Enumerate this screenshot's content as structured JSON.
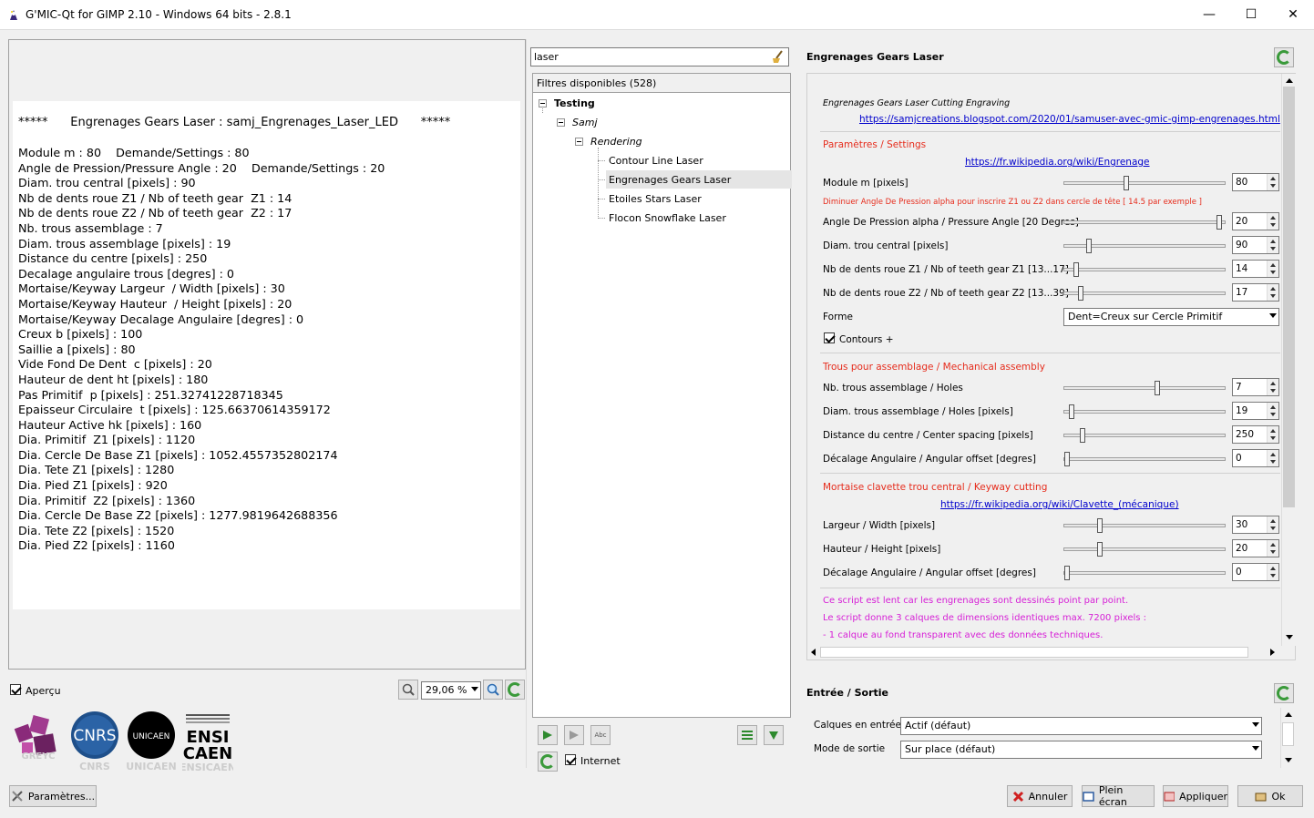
{
  "window": {
    "title": "G'MIC-Qt for GIMP 2.10 - Windows 64 bits - 2.8.1",
    "minimize": "—",
    "maximize": "☐",
    "close": "✕"
  },
  "preview": {
    "header": "*****      Engrenages Gears Laser : samj_Engrenages_Laser_LED      *****",
    "lines": [
      "Module m : 80    Demande/Settings : 80",
      "Angle de Pression/Pressure Angle : 20    Demande/Settings : 20",
      "Diam. trou central [pixels] : 90",
      "Nb de dents roue Z1 / Nb of teeth gear  Z1 : 14",
      "Nb de dents roue Z2 / Nb of teeth gear  Z2 : 17",
      "Nb. trous assemblage : 7",
      "Diam. trous assemblage [pixels] : 19",
      "Distance du centre [pixels] : 250",
      "Decalage angulaire trous [degres] : 0",
      "Mortaise/Keyway Largeur  / Width [pixels] : 30",
      "Mortaise/Keyway Hauteur  / Height [pixels] : 20",
      "Mortaise/Keyway Decalage Angulaire [degres] : 0",
      "Creux b [pixels] : 100",
      "Saillie a [pixels] : 80",
      "Vide Fond De Dent  c [pixels] : 20",
      "Hauteur de dent ht [pixels] : 180",
      "Pas Primitif  p [pixels] : 251.32741228718345",
      "Epaisseur Circulaire  t [pixels] : 125.66370614359172",
      "Hauteur Active hk [pixels] : 160",
      "Dia. Primitif  Z1 [pixels] : 1120",
      "Dia. Cercle De Base Z1 [pixels] : 1052.4557352802174",
      "Dia. Tete Z1 [pixels] : 1280",
      "Dia. Pied Z1 [pixels] : 920",
      "Dia. Primitif  Z2 [pixels] : 1360",
      "Dia. Cercle De Base Z2 [pixels] : 1277.9819642688356",
      "Dia. Tete Z2 [pixels] : 1520",
      "Dia. Pied Z2 [pixels] : 1160"
    ],
    "apercu_label": "Aperçu",
    "apercu_checked": true,
    "zoom": "29,06 %"
  },
  "logos": [
    {
      "name": "GREYC",
      "color": "#8a2a7a"
    },
    {
      "name": "CNRS",
      "color": "#1e4f8a"
    },
    {
      "name": "UNICAEN",
      "color": "#000000"
    },
    {
      "name": "ENSICAEN",
      "color": "#000000"
    }
  ],
  "params_button": "Paramètres...",
  "filters": {
    "search_value": "laser",
    "header": "Filtres disponibles (528)",
    "tree": {
      "root": "Testing",
      "author": "Samj",
      "category": "Rendering",
      "items": [
        "Contour Line Laser",
        "Engrenages Gears Laser",
        "Etoiles Stars Laser",
        "Flocon Snowflake Laser"
      ],
      "selected": "Engrenages Gears Laser"
    },
    "internet_label": "Internet",
    "internet_checked": true,
    "abc_icon_text": "Abc"
  },
  "filter_panel": {
    "name": "Engrenages Gears Laser",
    "description": "Engrenages Gears Laser Cutting Engraving",
    "link1": "https://samjcreations.blogspot.com/2020/01/samuser-avec-gmic-gimp-engrenages.html",
    "section_settings": "Paramètres / Settings",
    "link2": "https://fr.wikipedia.org/wiki/Engrenage",
    "module_label": "Module m [pixels]",
    "module_value": "80",
    "module_frac": 0.38,
    "warning": "Diminuer Angle De Pression alpha pour inscrire Z1 ou Z2 dans cercle de tête [ 14.5 par exemple ]",
    "angle_label": "Angle De Pression alpha / Pressure Angle [20 Degres]",
    "angle_value": "20",
    "angle_frac": 0.98,
    "diam_label": "Diam. trou central [pixels]",
    "diam_value": "90",
    "diam_frac": 0.14,
    "z1_label": "Nb de dents roue Z1 / Nb of teeth gear Z1  [13...17]",
    "z1_value": "14",
    "z1_frac": 0.06,
    "z2_label": "Nb de dents roue Z2 / Nb of teeth gear Z2 [13...39]",
    "z2_value": "17",
    "z2_frac": 0.09,
    "forme_label": "Forme",
    "forme_value": "Dent=Creux sur Cercle Primitif",
    "contours_label": "Contours +",
    "contours_checked": true,
    "section_holes": "Trous pour assemblage / Mechanical assembly",
    "holes_label": "Nb. trous assemblage / Holes",
    "holes_value": "7",
    "holes_frac": 0.58,
    "holes_diam_label": "Diam. trous assemblage / Holes [pixels]",
    "holes_diam_value": "19",
    "holes_diam_frac": 0.03,
    "dist_label": "Distance du centre / Center spacing [pixels]",
    "dist_value": "250",
    "dist_frac": 0.1,
    "offset_label": "Décalage Angulaire / Angular offset [degres]",
    "offset_value": "0",
    "offset_frac": 0.0,
    "section_keyway": "Mortaise clavette trou central / Keyway cutting",
    "link3": "https://fr.wikipedia.org/wiki/Clavette_(mécanique)",
    "width_label": "Largeur / Width [pixels]",
    "width_value": "30",
    "width_frac": 0.21,
    "height_label": "Hauteur / Height [pixels]",
    "height_value": "20",
    "height_frac": 0.21,
    "keyoffset_label": "Décalage Angulaire / Angular offset [degres]",
    "keyoffset_value": "0",
    "keyoffset_frac": 0.0,
    "note1": "Ce script est lent car les engrenages sont dessinés point par point.",
    "note2": "Le script donne 3 calques de dimensions identiques max. 7200 pixels :",
    "note3": "- 1 calque au fond transparent avec des données techniques."
  },
  "io": {
    "title": "Entrée / Sortie",
    "input_label": "Calques en entrée",
    "input_value": "Actif (défaut)",
    "output_label": "Mode de sortie",
    "output_value": "Sur place (défaut)"
  },
  "buttons": {
    "cancel": "Annuler",
    "fullscreen": "Plein écran",
    "apply": "Appliquer",
    "ok": "Ok"
  },
  "colors": {
    "red_heading": "#e62c1c",
    "link": "#0000cc",
    "magenta_note": "#d61fd6",
    "refresh_green": "#3a9a3a"
  }
}
